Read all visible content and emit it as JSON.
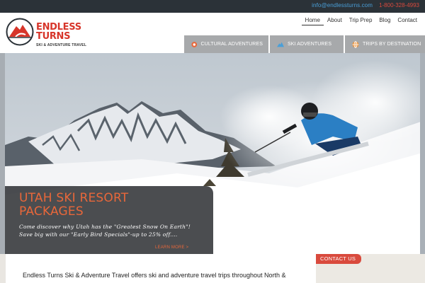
{
  "topbar": {
    "email": "info@endlessturns.com",
    "phone": "1-800-328-4993"
  },
  "logo": {
    "line1": "ENDLESS",
    "line2": "TURNS",
    "tagline": "SKI & ADVENTURE TRAVEL"
  },
  "topnav": {
    "items": [
      "Home",
      "About",
      "Trip Prep",
      "Blog",
      "Contact"
    ],
    "active": "Home"
  },
  "mainnav": {
    "items": [
      {
        "label": "CULTURAL ADVENTURES",
        "icon": "sun-icon",
        "color": "#e8673a"
      },
      {
        "label": "SKI ADVENTURES",
        "icon": "mountain-icon",
        "color": "#4a9fd8"
      },
      {
        "label": "TRIPS BY DESTINATION",
        "icon": "globe-icon",
        "color": "#e8913a"
      }
    ]
  },
  "hero": {
    "title": "UTAH SKI RESORT PACKAGES",
    "text": "Come discover why Utah has the \"Greatest Snow On Earth\"! Save big with our \"Early Bird Specials\"-up to 25% off....",
    "more": "LEARN MORE >"
  },
  "content": {
    "intro": "Endless Turns Ski & Adventure Travel offers ski and adventure travel trips throughout North &"
  },
  "sidebar": {
    "contact_tab": "CONTACT US"
  },
  "colors": {
    "accent_orange": "#e8673a",
    "brand_red": "#d7352a",
    "link_blue": "#4a9fd8",
    "topbar_bg": "#2b3238",
    "nav_gray": "#a7a9ab"
  }
}
